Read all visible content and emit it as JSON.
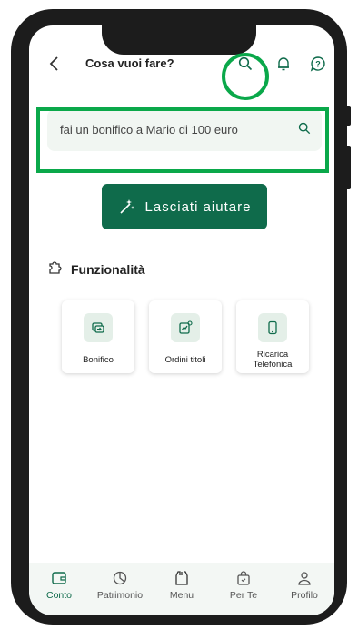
{
  "header": {
    "title": "Cosa vuoi fare?"
  },
  "search": {
    "value": "fai un bonifico a Mario di 100 euro"
  },
  "cta": {
    "label": "Lasciati aiutare"
  },
  "section": {
    "title": "Funzionalità"
  },
  "features": [
    {
      "label": "Bonifico",
      "icon": "transfer-icon"
    },
    {
      "label": "Ordini titoli",
      "icon": "securities-order-icon"
    },
    {
      "label": "Ricarica Telefonica",
      "icon": "phone-topup-icon"
    }
  ],
  "tabs": [
    {
      "label": "Conto",
      "icon": "wallet-icon",
      "active": true
    },
    {
      "label": "Patrimonio",
      "icon": "pie-chart-icon"
    },
    {
      "label": "Menu",
      "icon": "menu-icon"
    },
    {
      "label": "Per Te",
      "icon": "gift-bag-icon"
    },
    {
      "label": "Profilo",
      "icon": "profile-icon"
    }
  ],
  "colors": {
    "brand": "#0f6b4b",
    "highlight": "#0aa84a",
    "input_bg": "#f1f6f2"
  }
}
